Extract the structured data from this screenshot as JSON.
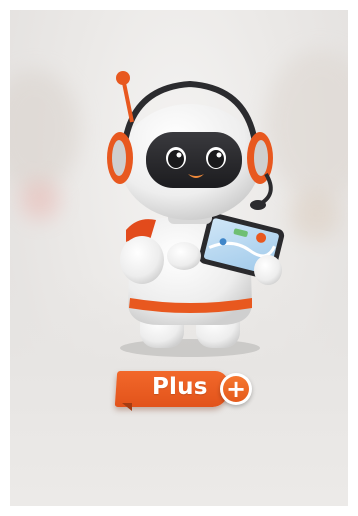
{
  "badge": {
    "label": "Plus",
    "icon": "plus-icon"
  },
  "colors": {
    "accent": "#e8581f",
    "robot_body": "#f3f3f3",
    "robot_visor": "#2b2b2e",
    "background": "#e8e6e4"
  },
  "illustration": {
    "icons": [
      "robot-mascot",
      "headset-icon",
      "tablet-icon",
      "map-icon"
    ]
  }
}
